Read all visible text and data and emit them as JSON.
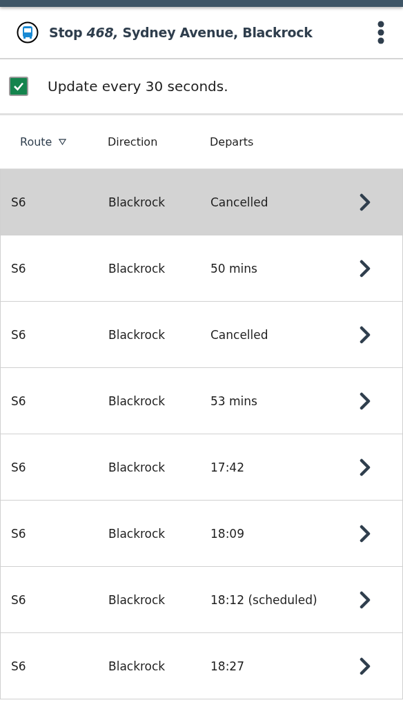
{
  "header": {
    "title": "Stop *468,* Sydney Avenue, Blackrock"
  },
  "auto_update": {
    "label": "Update every 30 seconds.",
    "checked": true
  },
  "table": {
    "columns": [
      "Route",
      "Direction",
      "Departs"
    ],
    "rows": [
      {
        "route": "S6",
        "direction": "Blackrock",
        "departs": "Cancelled",
        "selected": true
      },
      {
        "route": "S6",
        "direction": "Blackrock",
        "departs": "50 mins",
        "selected": false
      },
      {
        "route": "S6",
        "direction": "Blackrock",
        "departs": "Cancelled",
        "selected": false
      },
      {
        "route": "S6",
        "direction": "Blackrock",
        "departs": "53 mins",
        "selected": false
      },
      {
        "route": "S6",
        "direction": "Blackrock",
        "departs": "17:42",
        "selected": false
      },
      {
        "route": "S6",
        "direction": "Blackrock",
        "departs": "18:09",
        "selected": false
      },
      {
        "route": "S6",
        "direction": "Blackrock",
        "departs": "18:12 (scheduled)",
        "selected": false
      },
      {
        "route": "S6",
        "direction": "Blackrock",
        "departs": "18:27",
        "selected": false
      }
    ]
  }
}
